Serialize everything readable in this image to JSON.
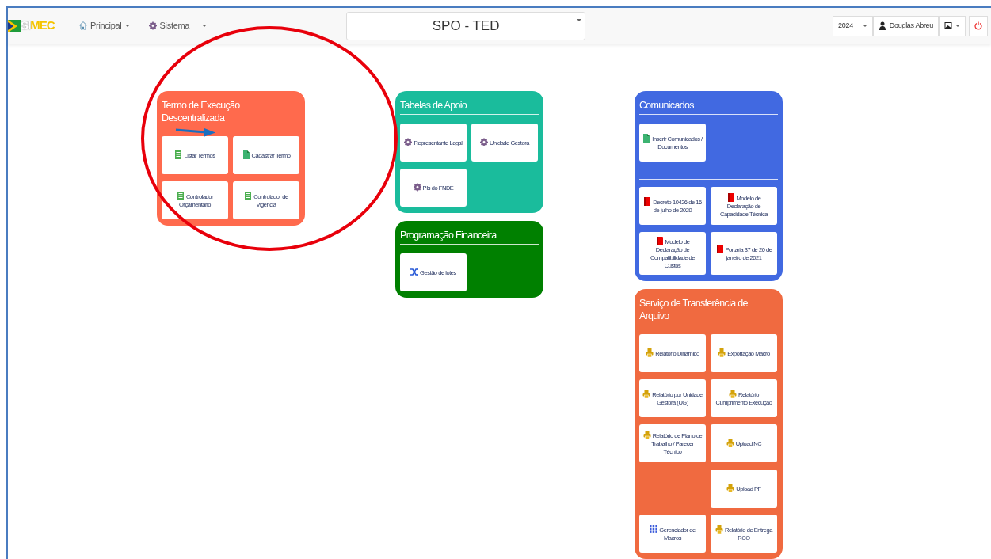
{
  "navbar": {
    "logo_prefix": "SI",
    "logo_suffix": "MEC",
    "menus": [
      {
        "label": "Principal",
        "kind": "home"
      },
      {
        "label": "Sistema",
        "kind": "gear"
      }
    ],
    "system_select": "SPO - TED",
    "year": "2024",
    "user": "Douglas Abreu"
  },
  "columns": [
    [
      {
        "title": "Termo de Execução Descentralizada",
        "color": "#ff6a4d",
        "sections": [
          [
            {
              "label": "Listar Termos",
              "kind": "list"
            },
            {
              "label": "Cadastrar Termo",
              "kind": "file"
            },
            {
              "label": "Controlador Orçamentário",
              "kind": "list"
            },
            {
              "label": "Controlador de Vigência",
              "kind": "list"
            }
          ]
        ]
      }
    ],
    [
      {
        "title": "Tabelas de Apoio",
        "color": "#1abc9c",
        "sections": [
          [
            {
              "label": "Representante Legal",
              "kind": "gear"
            },
            {
              "label": "Unidade Gestora",
              "kind": "gear"
            },
            {
              "label": "PIs do FNDE",
              "kind": "gear"
            }
          ]
        ]
      },
      {
        "title": "Programação Financeira",
        "color": "#008000",
        "sections": [
          [
            {
              "label": "Gestão de lotes",
              "kind": "shuffle"
            }
          ]
        ]
      }
    ],
    [
      {
        "title": "Comunicados",
        "color": "#4169e1",
        "sections": [
          [
            {
              "label": "Inserir Comunicados / Documentos",
              "kind": "file"
            }
          ],
          [
            {
              "label": "Decreto 10426 de 16 de julho de 2020",
              "kind": "book"
            },
            {
              "label": "Modelo de Declaração de Capacidade Técnica",
              "kind": "book"
            },
            {
              "label": "Modelo de Declaração de Compatibilidade de Custos",
              "kind": "book"
            },
            {
              "label": "Portaria 37 de 20 de janeiro de 2021",
              "kind": "book"
            }
          ]
        ]
      },
      {
        "title": "Serviço de Transferência de Arquivo",
        "color": "#f06a40",
        "sections": [
          [
            {
              "label": "Relatório Dinâmico",
              "kind": "print"
            },
            {
              "label": "Exportação Macro",
              "kind": "print"
            },
            {
              "label": "Relatório por Unidade Gestora (UG)",
              "kind": "print"
            },
            {
              "label": "Relatório Cumprimento Execução",
              "kind": "print"
            },
            {
              "label": "Relatório de Plano de Trabalho / Parecer Técnico",
              "kind": "print"
            },
            {
              "label": "Upload NC",
              "kind": "print"
            },
            {
              "kind": "spacer"
            },
            {
              "label": "Upload PF",
              "kind": "print"
            },
            {
              "label": "Gerenciador de Macros",
              "kind": "grid"
            },
            {
              "label": "Relatório de Entrega RCO",
              "kind": "print"
            }
          ]
        ]
      }
    ]
  ],
  "annotations": {
    "ellipse": true,
    "arrow": true
  }
}
